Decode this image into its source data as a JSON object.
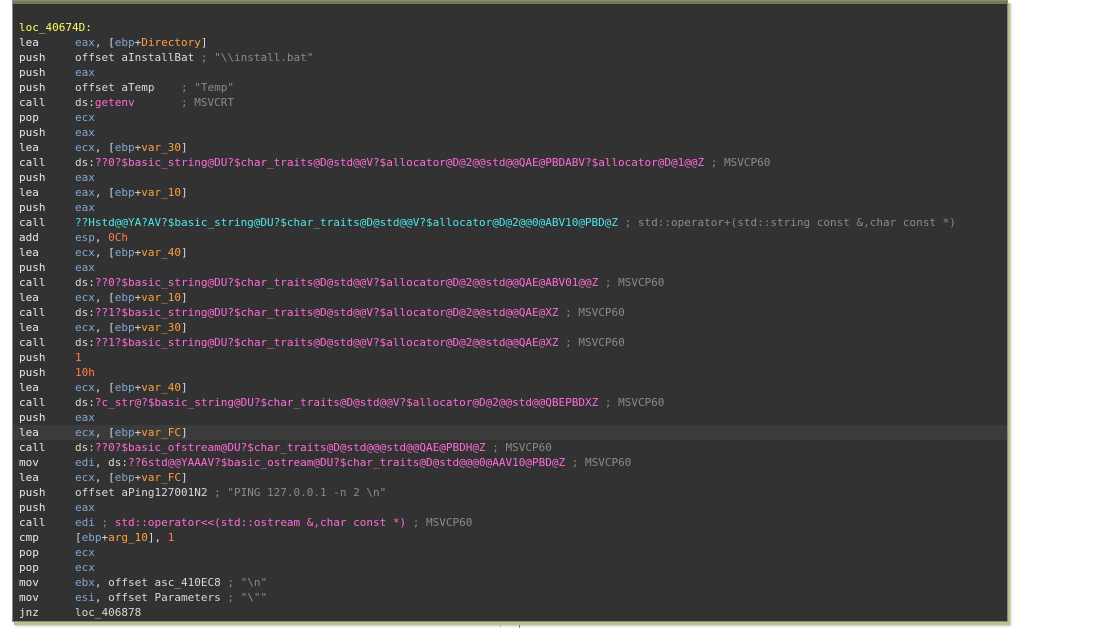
{
  "code": {
    "label": "loc_40674D:",
    "lines": [
      {
        "m": "lea",
        "ops": [
          [
            "reg",
            "eax"
          ],
          [
            "plain",
            ", ["
          ],
          [
            "reg",
            "ebp"
          ],
          [
            "plain",
            "+"
          ],
          [
            "var",
            "Directory"
          ],
          [
            "plain",
            "]"
          ]
        ]
      },
      {
        "m": "push",
        "ops": [
          [
            "plain",
            "offset aInstallBat "
          ],
          [
            "cmt",
            "; \"\\\\install.bat\""
          ]
        ]
      },
      {
        "m": "push",
        "ops": [
          [
            "reg",
            "eax"
          ]
        ]
      },
      {
        "m": "push",
        "ops": [
          [
            "plain",
            "offset aTemp    "
          ],
          [
            "cmt",
            "; \"Temp\""
          ]
        ]
      },
      {
        "m": "call",
        "ops": [
          [
            "plain",
            "ds:"
          ],
          [
            "dsname",
            "getenv"
          ],
          [
            "cmt",
            "       ; MSVCRT"
          ]
        ]
      },
      {
        "m": "pop",
        "ops": [
          [
            "reg",
            "ecx"
          ]
        ]
      },
      {
        "m": "push",
        "ops": [
          [
            "reg",
            "eax"
          ]
        ]
      },
      {
        "m": "lea",
        "ops": [
          [
            "reg",
            "ecx"
          ],
          [
            "plain",
            ", ["
          ],
          [
            "reg",
            "ebp"
          ],
          [
            "plain",
            "+"
          ],
          [
            "var",
            "var_30"
          ],
          [
            "plain",
            "]"
          ]
        ]
      },
      {
        "m": "call",
        "ops": [
          [
            "plain",
            "ds:"
          ],
          [
            "imp",
            "??0?$basic_string@DU?$char_traits@D@std@@V?$allocator@D@2@@std@@QAE@PBDABV?$allocator@D@1@@Z"
          ],
          [
            "cmt",
            " ; MSVCP60"
          ]
        ]
      },
      {
        "m": "push",
        "ops": [
          [
            "reg",
            "eax"
          ]
        ]
      },
      {
        "m": "lea",
        "ops": [
          [
            "reg",
            "eax"
          ],
          [
            "plain",
            ", ["
          ],
          [
            "reg",
            "ebp"
          ],
          [
            "plain",
            "+"
          ],
          [
            "var",
            "var_10"
          ],
          [
            "plain",
            "]"
          ]
        ]
      },
      {
        "m": "push",
        "ops": [
          [
            "reg",
            "eax"
          ]
        ]
      },
      {
        "m": "call",
        "ops": [
          [
            "call-cyan",
            "??Hstd@@YA?AV?$basic_string@DU?$char_traits@D@std@@V?$allocator@D@2@@0@ABV10@PBD@Z"
          ],
          [
            "cmt",
            " ; std::operator+(std::string const &,char const *)"
          ]
        ]
      },
      {
        "m": "add",
        "ops": [
          [
            "reg",
            "esp"
          ],
          [
            "plain",
            ", "
          ],
          [
            "num",
            "0Ch"
          ]
        ]
      },
      {
        "m": "lea",
        "ops": [
          [
            "reg",
            "ecx"
          ],
          [
            "plain",
            ", ["
          ],
          [
            "reg",
            "ebp"
          ],
          [
            "plain",
            "+"
          ],
          [
            "var",
            "var_40"
          ],
          [
            "plain",
            "]"
          ]
        ]
      },
      {
        "m": "push",
        "ops": [
          [
            "reg",
            "eax"
          ]
        ]
      },
      {
        "m": "call",
        "ops": [
          [
            "plain",
            "ds:"
          ],
          [
            "imp",
            "??0?$basic_string@DU?$char_traits@D@std@@V?$allocator@D@2@@std@@QAE@ABV01@@Z"
          ],
          [
            "cmt",
            " ; MSVCP60"
          ]
        ]
      },
      {
        "m": "lea",
        "ops": [
          [
            "reg",
            "ecx"
          ],
          [
            "plain",
            ", ["
          ],
          [
            "reg",
            "ebp"
          ],
          [
            "plain",
            "+"
          ],
          [
            "var",
            "var_10"
          ],
          [
            "plain",
            "]"
          ]
        ]
      },
      {
        "m": "call",
        "ops": [
          [
            "plain",
            "ds:"
          ],
          [
            "imp",
            "??1?$basic_string@DU?$char_traits@D@std@@V?$allocator@D@2@@std@@QAE@XZ"
          ],
          [
            "cmt",
            " ; MSVCP60"
          ]
        ]
      },
      {
        "m": "lea",
        "ops": [
          [
            "reg",
            "ecx"
          ],
          [
            "plain",
            ", ["
          ],
          [
            "reg",
            "ebp"
          ],
          [
            "plain",
            "+"
          ],
          [
            "var",
            "var_30"
          ],
          [
            "plain",
            "]"
          ]
        ]
      },
      {
        "m": "call",
        "ops": [
          [
            "plain",
            "ds:"
          ],
          [
            "imp",
            "??1?$basic_string@DU?$char_traits@D@std@@V?$allocator@D@2@@std@@QAE@XZ"
          ],
          [
            "cmt",
            " ; MSVCP60"
          ]
        ]
      },
      {
        "m": "push",
        "ops": [
          [
            "num",
            "1"
          ]
        ]
      },
      {
        "m": "push",
        "ops": [
          [
            "num",
            "10h"
          ]
        ]
      },
      {
        "m": "lea",
        "ops": [
          [
            "reg",
            "ecx"
          ],
          [
            "plain",
            ", ["
          ],
          [
            "reg",
            "ebp"
          ],
          [
            "plain",
            "+"
          ],
          [
            "var",
            "var_40"
          ],
          [
            "plain",
            "]"
          ]
        ]
      },
      {
        "m": "call",
        "ops": [
          [
            "plain",
            "ds:"
          ],
          [
            "imp",
            "?c_str@?$basic_string@DU?$char_traits@D@std@@V?$allocator@D@2@@std@@QBEPBDXZ"
          ],
          [
            "cmt",
            " ; MSVCP60"
          ]
        ]
      },
      {
        "m": "push",
        "ops": [
          [
            "reg",
            "eax"
          ]
        ]
      },
      {
        "m": "lea",
        "ops": [
          [
            "reg",
            "ecx"
          ],
          [
            "plain",
            ", ["
          ],
          [
            "reg",
            "ebp"
          ],
          [
            "plain",
            "+"
          ],
          [
            "var",
            "var_FC"
          ],
          [
            "plain",
            "]"
          ]
        ]
      },
      {
        "m": "call",
        "ops": [
          [
            "plain",
            "ds:"
          ],
          [
            "imp",
            "??0?$basic_ofstream@DU?$char_traits@D@std@@@std@@QAE@PBDH@Z"
          ],
          [
            "cmt",
            " ; MSVCP60"
          ]
        ]
      },
      {
        "m": "mov",
        "ops": [
          [
            "reg",
            "edi"
          ],
          [
            "plain",
            ", ds:"
          ],
          [
            "imp",
            "??6std@@YAAAV?$basic_ostream@DU?$char_traits@D@std@@@0@AAV10@PBD@Z"
          ],
          [
            "cmt",
            " ; MSVCP60"
          ]
        ]
      },
      {
        "m": "lea",
        "ops": [
          [
            "reg",
            "ecx"
          ],
          [
            "plain",
            ", ["
          ],
          [
            "reg",
            "ebp"
          ],
          [
            "plain",
            "+"
          ],
          [
            "var",
            "var_FC"
          ],
          [
            "plain",
            "]"
          ]
        ]
      },
      {
        "m": "push",
        "ops": [
          [
            "plain",
            "offset aPing127001N2 "
          ],
          [
            "cmt",
            "; \"PING 127.0.0.1 -n 2 \\n\""
          ]
        ]
      },
      {
        "m": "push",
        "ops": [
          [
            "reg",
            "eax"
          ]
        ]
      },
      {
        "m": "call",
        "ops": [
          [
            "reg",
            "edi"
          ],
          [
            "cmt",
            " ; "
          ],
          [
            "imp",
            "std::operator<<(std::ostream &,char const *)"
          ],
          [
            "cmt",
            " ; MSVCP60"
          ]
        ]
      },
      {
        "m": "cmp",
        "ops": [
          [
            "plain",
            "["
          ],
          [
            "reg",
            "ebp"
          ],
          [
            "plain",
            "+"
          ],
          [
            "var",
            "arg_10"
          ],
          [
            "plain",
            "], "
          ],
          [
            "num",
            "1"
          ]
        ]
      },
      {
        "m": "pop",
        "ops": [
          [
            "reg",
            "ecx"
          ]
        ]
      },
      {
        "m": "pop",
        "ops": [
          [
            "reg",
            "ecx"
          ]
        ]
      },
      {
        "m": "mov",
        "ops": [
          [
            "reg",
            "ebx"
          ],
          [
            "plain",
            ", offset asc_410EC8 "
          ],
          [
            "cmt",
            "; \"\\n\""
          ]
        ]
      },
      {
        "m": "mov",
        "ops": [
          [
            "reg",
            "esi"
          ],
          [
            "plain",
            ", offset Parameters "
          ],
          [
            "cmt",
            "; \"\\\"\""
          ]
        ]
      },
      {
        "m": "jnz",
        "ops": [
          [
            "plain",
            "loc_406878"
          ]
        ]
      }
    ],
    "current_line_index": 26
  }
}
